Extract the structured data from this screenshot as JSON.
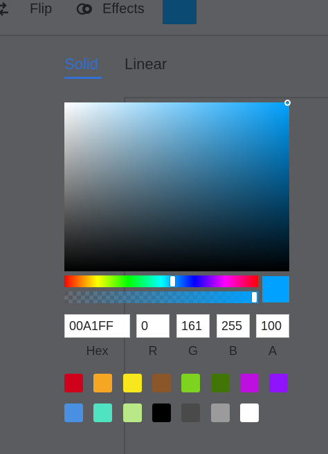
{
  "toolbar": {
    "flip_label": "Flip",
    "effects_label": "Effects",
    "flip_icon": "flip-icon",
    "effects_icon": "effects-icon",
    "current_color": "#0b4b73"
  },
  "tabs": {
    "solid": "Solid",
    "linear": "Linear",
    "active": "Solid"
  },
  "picker": {
    "color": "#00A1FF",
    "hue_position": 0.56,
    "alpha": 1.0
  },
  "fields": {
    "hex": {
      "label": "Hex",
      "value": "00A1FF"
    },
    "r": {
      "label": "R",
      "value": "0"
    },
    "g": {
      "label": "G",
      "value": "161"
    },
    "b": {
      "label": "B",
      "value": "255"
    },
    "a": {
      "label": "A",
      "value": "100"
    }
  },
  "swatches": {
    "row1": [
      "#d0021b",
      "#f5a623",
      "#f8e71c",
      "#8b572a",
      "#7ed321",
      "#417505",
      "#bd10e0",
      "#9013fe"
    ],
    "row2": [
      "#4a90e2",
      "#50e3c2",
      "#b8e986",
      "#000000",
      "#4a4a4a",
      "#9b9b9b",
      "#ffffff"
    ]
  }
}
